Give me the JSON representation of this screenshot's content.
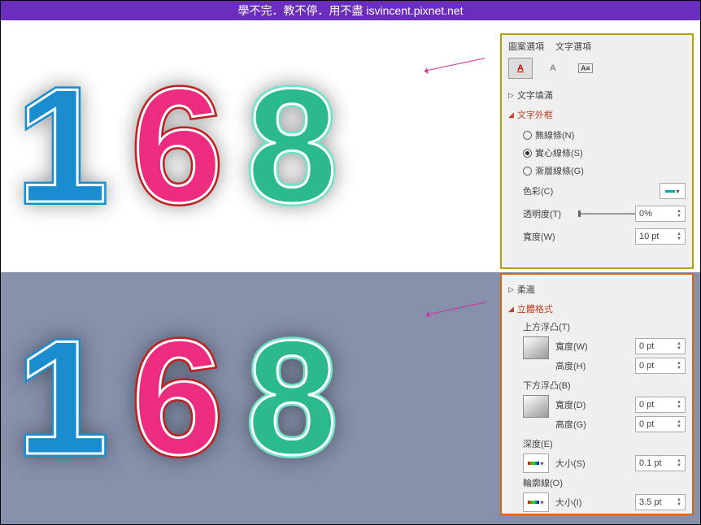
{
  "header": "學不完．教不停．用不盡 isvincent.pixnet.net",
  "numbers": {
    "n1": "1",
    "n6": "6",
    "n8": "8"
  },
  "panel1": {
    "tab_shape": "圖案選項",
    "tab_text": "文字選項",
    "sec_fill": "文字填滿",
    "sec_outline": "文字外框",
    "r_none": "無線條(N)",
    "r_solid": "實心線條(S)",
    "r_grad": "漸層線條(G)",
    "lbl_color": "色彩(C)",
    "lbl_trans": "透明度(T)",
    "val_trans": "0%",
    "lbl_width": "寬度(W)",
    "val_width": "10 pt"
  },
  "panel2": {
    "sec_soft": "柔邊",
    "sec_3d": "立體格式",
    "top_bevel": "上方浮凸(T)",
    "bot_bevel": "下方浮凸(B)",
    "lbl_w": "寬度(W)",
    "lbl_h": "高度(H)",
    "lbl_d": "寬度(D)",
    "lbl_g": "高度(G)",
    "val_0": "0 pt",
    "depth": "深度(E)",
    "size_s": "大小(S)",
    "val_depth": "0.1 pt",
    "contour": "輪廓線(O)",
    "size_i": "大小(I)",
    "val_contour": "3.5 pt"
  }
}
